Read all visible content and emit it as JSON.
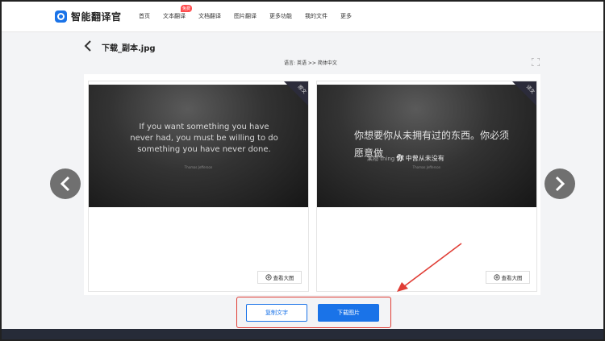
{
  "app": {
    "logo_text": "智能翻译官"
  },
  "nav": {
    "items": [
      {
        "label": "首页"
      },
      {
        "label": "文本翻译",
        "badge": "免费"
      },
      {
        "label": "文档翻译"
      },
      {
        "label": "图片翻译"
      },
      {
        "label": "更多功能"
      },
      {
        "label": "我的文件"
      },
      {
        "label": "更多"
      }
    ]
  },
  "page": {
    "file_title": "下载_副本.jpg",
    "language_label": "语言:",
    "source_lang": "英语",
    "separator": ">>",
    "target_lang": "简体中文"
  },
  "left_card": {
    "ribbon": "原文",
    "quote": "If you want something you have never had, you must be willing to do something you have never done.",
    "author": "Thomas Jefferson",
    "view_label": "查看大图"
  },
  "right_card": {
    "ribbon": "译文",
    "quote": "你想要你从未拥有过的东西。你必须愿意做",
    "garble_a": "某物",
    "garble_b": "thing",
    "garble_c": "你",
    "garble_d": "中曾从未没有",
    "author": "Thomas Jefferson",
    "view_label": "查看大图"
  },
  "actions": {
    "copy_label": "复制文字",
    "download_label": "下载图片"
  },
  "colors": {
    "accent": "#1a73e8",
    "highlight": "#e03d35",
    "footer": "#262b38"
  },
  "icons": {
    "back": "chevron-left-icon",
    "fullscreen": "expand-icon",
    "zoom": "zoom-in-icon",
    "prev": "chevron-left-icon",
    "next": "chevron-right-icon"
  }
}
